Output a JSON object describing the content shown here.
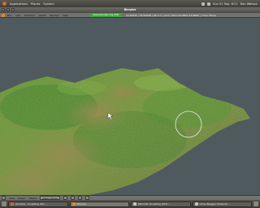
{
  "top_panel": {
    "applications": "Applications",
    "places": "Places",
    "system": "System",
    "clock": "Sun 21 Sep, 6:21",
    "user": "Ron Watson"
  },
  "window": {
    "title": "Blender"
  },
  "info_header": {
    "menus": [
      "File",
      "Add",
      "Timeline",
      "Game",
      "Render",
      "Help"
    ],
    "url": "www.blender.org 248",
    "stats": "Ve:28225 | Fa:56448 | Ob:1-1 | La:0 | Mem:10.88M (18.86M) | Time: Plane"
  },
  "view_header": {
    "view": "View",
    "select": "Select",
    "object": "Object",
    "mode": "Object Mode"
  },
  "taskbar": {
    "tasks": [
      {
        "label": "YouTube - Sculpting Terr...",
        "icon": "firefox-icon"
      },
      {
        "label": "Blender",
        "icon": "blender-icon"
      },
      {
        "label": "[Blender Sculpting (SCU...",
        "icon": "folder-icon"
      },
      {
        "label": "Gimp Blogger Cliverick...",
        "icon": "gimp-icon"
      }
    ]
  },
  "colors": {
    "viewport_bg": "#4f5a5e",
    "grass": "#4e8a2c",
    "dirt": "#7d6a3e",
    "accent_url": "#3fa63a"
  }
}
